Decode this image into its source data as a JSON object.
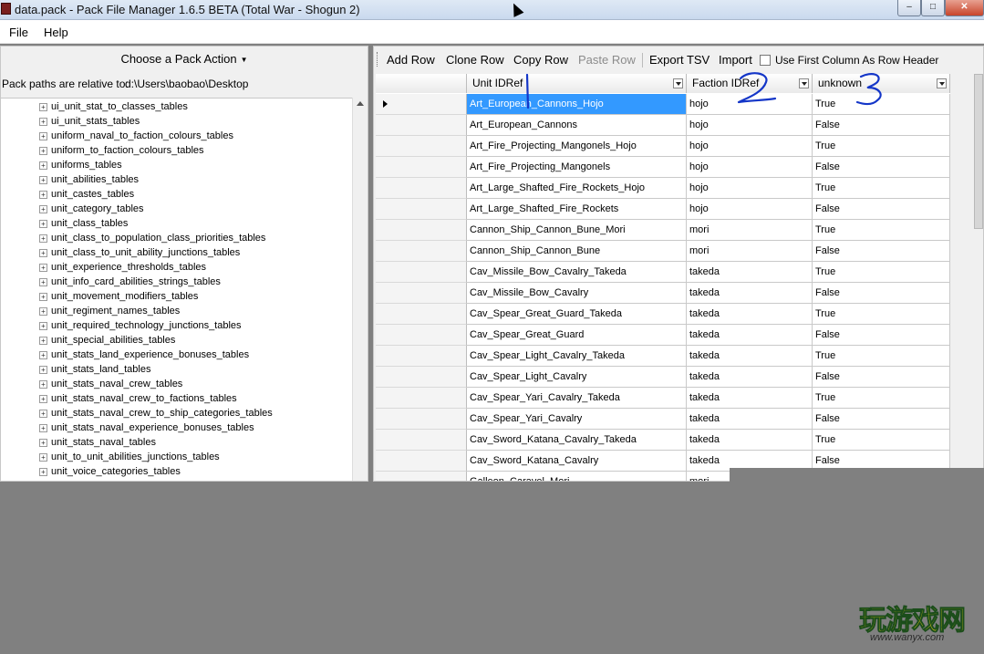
{
  "window": {
    "title": "data.pack - Pack File Manager 1.6.5 BETA (Total War - Shogun 2)",
    "min_label": "–",
    "max_label": "□",
    "close_label": "✕"
  },
  "menu": {
    "file": "File",
    "help": "Help"
  },
  "left": {
    "pack_action": "Choose a Pack Action",
    "path_label": "Pack paths are relative to:",
    "path_value": "d:\\Users\\baobao\\Desktop",
    "tree_items": [
      "ui_unit_stat_to_classes_tables",
      "ui_unit_stats_tables",
      "uniform_naval_to_faction_colours_tables",
      "uniform_to_faction_colours_tables",
      "uniforms_tables",
      "unit_abilities_tables",
      "unit_castes_tables",
      "unit_category_tables",
      "unit_class_tables",
      "unit_class_to_population_class_priorities_tables",
      "unit_class_to_unit_ability_junctions_tables",
      "unit_experience_thresholds_tables",
      "unit_info_card_abilities_strings_tables",
      "unit_movement_modifiers_tables",
      "unit_regiment_names_tables",
      "unit_required_technology_junctions_tables",
      "unit_special_abilities_tables",
      "unit_stats_land_experience_bonuses_tables",
      "unit_stats_land_tables",
      "unit_stats_naval_crew_tables",
      "unit_stats_naval_crew_to_factions_tables",
      "unit_stats_naval_crew_to_ship_categories_tables",
      "unit_stats_naval_experience_bonuses_tables",
      "unit_stats_naval_tables",
      "unit_to_unit_abilities_junctions_tables",
      "unit_voice_categories_tables"
    ]
  },
  "toolbar": {
    "add_row": "Add Row",
    "clone_row": "Clone Row",
    "copy_row": "Copy Row",
    "paste_row": "Paste Row",
    "export_tsv": "Export TSV",
    "import": "Import",
    "first_col_header": "Use First Column As Row Header"
  },
  "grid": {
    "columns": [
      "Unit IDRef",
      "Faction IDRef",
      "unknown"
    ],
    "rows": [
      [
        "Art_European_Cannons_Hojo",
        "hojo",
        "True"
      ],
      [
        "Art_European_Cannons",
        "hojo",
        "False"
      ],
      [
        "Art_Fire_Projecting_Mangonels_Hojo",
        "hojo",
        "True"
      ],
      [
        "Art_Fire_Projecting_Mangonels",
        "hojo",
        "False"
      ],
      [
        "Art_Large_Shafted_Fire_Rockets_Hojo",
        "hojo",
        "True"
      ],
      [
        "Art_Large_Shafted_Fire_Rockets",
        "hojo",
        "False"
      ],
      [
        "Cannon_Ship_Cannon_Bune_Mori",
        "mori",
        "True"
      ],
      [
        "Cannon_Ship_Cannon_Bune",
        "mori",
        "False"
      ],
      [
        "Cav_Missile_Bow_Cavalry_Takeda",
        "takeda",
        "True"
      ],
      [
        "Cav_Missile_Bow_Cavalry",
        "takeda",
        "False"
      ],
      [
        "Cav_Spear_Great_Guard_Takeda",
        "takeda",
        "True"
      ],
      [
        "Cav_Spear_Great_Guard",
        "takeda",
        "False"
      ],
      [
        "Cav_Spear_Light_Cavalry_Takeda",
        "takeda",
        "True"
      ],
      [
        "Cav_Spear_Light_Cavalry",
        "takeda",
        "False"
      ],
      [
        "Cav_Spear_Yari_Cavalry_Takeda",
        "takeda",
        "True"
      ],
      [
        "Cav_Spear_Yari_Cavalry",
        "takeda",
        "False"
      ],
      [
        "Cav_Sword_Katana_Cavalry_Takeda",
        "takeda",
        "True"
      ],
      [
        "Cav_Sword_Katana_Cavalry",
        "takeda",
        "False"
      ],
      [
        "Galleon_Caravel_Mori",
        "mori",
        ""
      ]
    ],
    "selected_row": 0
  },
  "annotations": [
    "1",
    "2",
    "3"
  ],
  "watermark": {
    "main": "玩游戏网",
    "url": "www.wanyx.com"
  },
  "colors": {
    "selection": "#3399ff",
    "annotation_ink": "#1436c8",
    "watermark": "#f3d21b"
  }
}
